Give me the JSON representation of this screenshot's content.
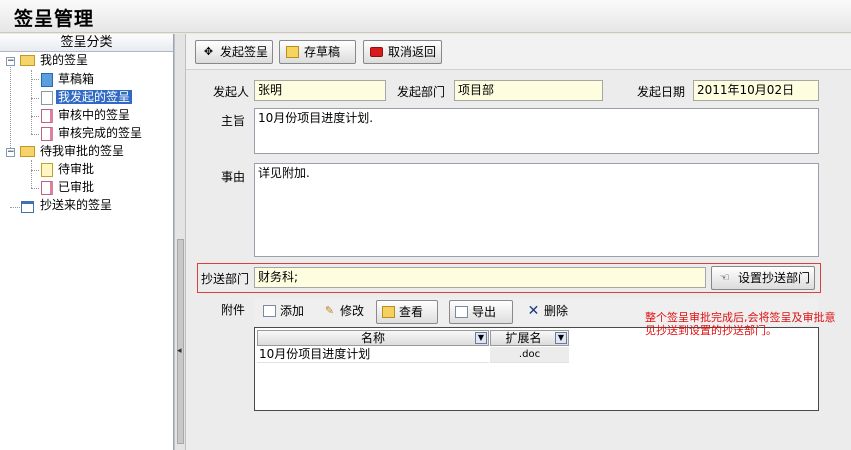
{
  "app": {
    "title": "签呈管理"
  },
  "sidebar": {
    "header": "签呈分类",
    "tree": [
      {
        "label": "我的签呈",
        "toggle": "−",
        "icon": "folder-icon"
      },
      {
        "label": "草稿箱",
        "icon": "draft-icon"
      },
      {
        "label": "我发起的签呈",
        "icon": "document-icon",
        "selected": true
      },
      {
        "label": "审核中的签呈",
        "icon": "document-icon"
      },
      {
        "label": "审核完成的签呈",
        "icon": "document-icon"
      },
      {
        "label": "待我审批的签呈",
        "toggle": "−",
        "icon": "folder-icon"
      },
      {
        "label": "待审批",
        "icon": "document-icon"
      },
      {
        "label": "已审批",
        "icon": "document-icon"
      },
      {
        "label": "抄送来的签呈",
        "icon": "calendar-icon"
      }
    ]
  },
  "toolbar": {
    "submit_label": "发起签呈",
    "save_draft_label": "存草稿",
    "cancel_label": "取消返回"
  },
  "form": {
    "initiator_label": "发起人",
    "initiator_value": "张明",
    "department_label": "发起部门",
    "department_value": "项目部",
    "date_label": "发起日期",
    "date_value": "2011年10月02日",
    "subject_label": "主旨",
    "subject_value": "10月份项目进度计划.",
    "matter_label": "事由",
    "matter_value": "详见附加.",
    "cc_label": "抄送部门",
    "cc_value": "财务科;",
    "cc_button_label": "设置抄送部门"
  },
  "attachments": {
    "label": "附件",
    "add_label": "添加",
    "edit_label": "修改",
    "view_label": "查看",
    "export_label": "导出",
    "delete_label": "删除",
    "columns": [
      "名称",
      "扩展名"
    ],
    "rows": [
      {
        "name": "10月份项目进度计划",
        "ext": ".doc"
      }
    ]
  },
  "note": "整个签呈审批完成后,会将签呈及审批意见抄送到设置的抄送部门。",
  "colors": {
    "note": "#e01010",
    "selection": "#316ac5",
    "cc_border": "#d94040"
  }
}
